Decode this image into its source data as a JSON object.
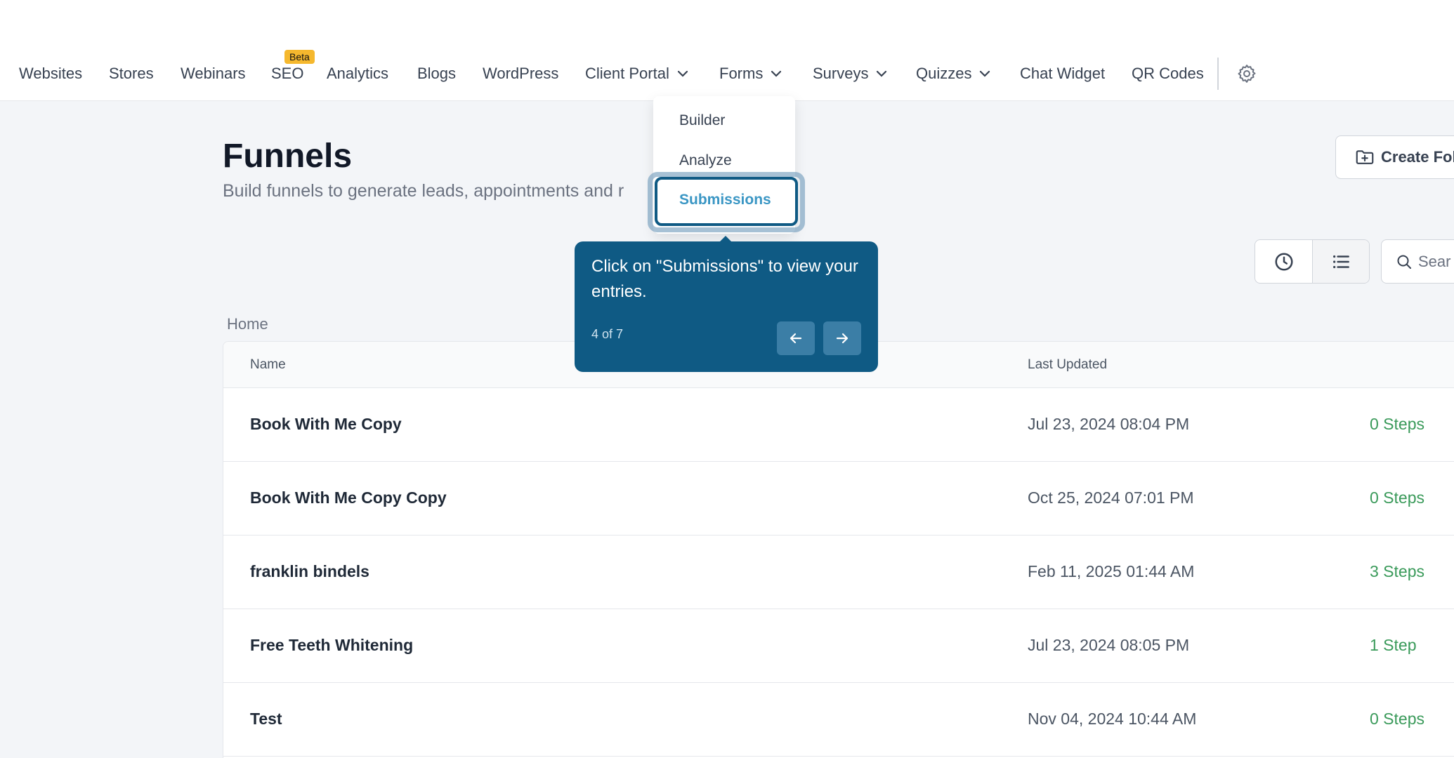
{
  "nav": {
    "items": [
      {
        "label": "Websites"
      },
      {
        "label": "Stores"
      },
      {
        "label": "Webinars"
      },
      {
        "label": "SEO",
        "badge": "Beta"
      },
      {
        "label": "Analytics"
      },
      {
        "label": "Blogs"
      },
      {
        "label": "WordPress"
      },
      {
        "label": "Client Portal",
        "dropdown": true
      },
      {
        "label": "Forms",
        "dropdown": true
      },
      {
        "label": "Surveys",
        "dropdown": true
      },
      {
        "label": "Quizzes",
        "dropdown": true
      },
      {
        "label": "Chat Widget"
      },
      {
        "label": "QR Codes"
      }
    ],
    "settings_icon": "gear-icon"
  },
  "forms_dropdown": {
    "items": [
      {
        "label": "Builder"
      },
      {
        "label": "Analyze"
      },
      {
        "label": "Submissions",
        "highlighted": true
      }
    ]
  },
  "page": {
    "title": "Funnels",
    "subtitle": "Build funnels to generate leads, appointments and r",
    "create_button": "Create Fol",
    "search_placeholder": "Sear",
    "breadcrumb": "Home"
  },
  "table": {
    "columns": [
      "Name",
      "Last Updated"
    ],
    "rows": [
      {
        "name": "Book With Me Copy",
        "updated": "Jul 23, 2024 08:04 PM",
        "steps": "0 Steps"
      },
      {
        "name": "Book With Me Copy Copy",
        "updated": "Oct 25, 2024 07:01 PM",
        "steps": "0 Steps"
      },
      {
        "name": "franklin bindels",
        "updated": "Feb 11, 2025 01:44 AM",
        "steps": "3 Steps"
      },
      {
        "name": "Free Teeth Whitening",
        "updated": "Jul 23, 2024 08:05 PM",
        "steps": "1 Step"
      },
      {
        "name": "Test",
        "updated": "Nov 04, 2024 10:44 AM",
        "steps": "0 Steps"
      }
    ]
  },
  "tooltip": {
    "text": "Click on \"Submissions\" to view your entries.",
    "step": "4 of 7"
  },
  "colors": {
    "tooltip_bg": "#0f5a84",
    "steps_green": "#3a9a5a",
    "submissions_blue": "#3a96c4",
    "beta_badge": "#f5b82e"
  }
}
